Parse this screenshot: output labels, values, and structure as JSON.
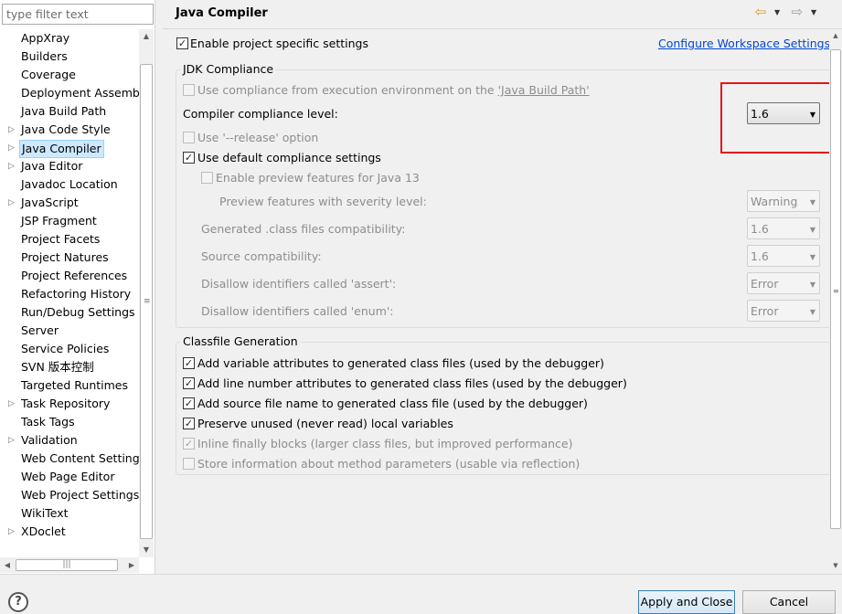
{
  "filter": {
    "placeholder": "type filter text"
  },
  "tree": {
    "items": [
      {
        "label": "AppXray",
        "expandable": false,
        "selected": false
      },
      {
        "label": "Builders",
        "expandable": false,
        "selected": false
      },
      {
        "label": "Coverage",
        "expandable": false,
        "selected": false
      },
      {
        "label": "Deployment Assembly",
        "expandable": false,
        "selected": false
      },
      {
        "label": "Java Build Path",
        "expandable": false,
        "selected": false
      },
      {
        "label": "Java Code Style",
        "expandable": true,
        "selected": false
      },
      {
        "label": "Java Compiler",
        "expandable": true,
        "selected": true
      },
      {
        "label": "Java Editor",
        "expandable": true,
        "selected": false
      },
      {
        "label": "Javadoc Location",
        "expandable": false,
        "selected": false
      },
      {
        "label": "JavaScript",
        "expandable": true,
        "selected": false
      },
      {
        "label": "JSP Fragment",
        "expandable": false,
        "selected": false
      },
      {
        "label": "Project Facets",
        "expandable": false,
        "selected": false
      },
      {
        "label": "Project Natures",
        "expandable": false,
        "selected": false
      },
      {
        "label": "Project References",
        "expandable": false,
        "selected": false
      },
      {
        "label": "Refactoring History",
        "expandable": false,
        "selected": false
      },
      {
        "label": "Run/Debug Settings",
        "expandable": false,
        "selected": false
      },
      {
        "label": "Server",
        "expandable": false,
        "selected": false
      },
      {
        "label": "Service Policies",
        "expandable": false,
        "selected": false
      },
      {
        "label": "SVN 版本控制",
        "expandable": false,
        "selected": false
      },
      {
        "label": "Targeted Runtimes",
        "expandable": false,
        "selected": false
      },
      {
        "label": "Task Repository",
        "expandable": true,
        "selected": false
      },
      {
        "label": "Task Tags",
        "expandable": false,
        "selected": false
      },
      {
        "label": "Validation",
        "expandable": true,
        "selected": false
      },
      {
        "label": "Web Content Settings",
        "expandable": false,
        "selected": false
      },
      {
        "label": "Web Page Editor",
        "expandable": false,
        "selected": false
      },
      {
        "label": "Web Project Settings",
        "expandable": false,
        "selected": false
      },
      {
        "label": "WikiText",
        "expandable": false,
        "selected": false
      },
      {
        "label": "XDoclet",
        "expandable": true,
        "selected": false
      }
    ]
  },
  "header": {
    "title": "Java Compiler",
    "icons": {
      "back": "arrow-left-icon",
      "forward": "arrow-right-icon",
      "menu": "chevron-down-icon"
    }
  },
  "settings": {
    "enable_project_specific": {
      "label": "Enable project specific settings",
      "checked": true
    },
    "configure_workspace_link": "Configure Workspace Settings...",
    "jdk_compliance": {
      "title": "JDK Compliance",
      "use_execution_env": {
        "prefix": "Use compliance from execution environment on the ",
        "link": "'Java Build Path'",
        "checked": false,
        "enabled": false
      },
      "compliance_level": {
        "label": "Compiler compliance level:",
        "value": "1.6"
      },
      "use_release": {
        "label": "Use '--release' option",
        "checked": false,
        "enabled": false
      },
      "use_default": {
        "label": "Use default compliance settings",
        "checked": true
      },
      "enable_preview": {
        "label": "Enable preview features for Java 13",
        "checked": false,
        "enabled": false
      },
      "preview_severity": {
        "label": "Preview features with severity level:",
        "value": "Warning"
      },
      "generated_class": {
        "label": "Generated .class files compatibility:",
        "value": "1.6"
      },
      "source_compat": {
        "label": "Source compatibility:",
        "value": "1.6"
      },
      "disallow_assert": {
        "label": "Disallow identifiers called 'assert':",
        "value": "Error"
      },
      "disallow_enum": {
        "label": "Disallow identifiers called 'enum':",
        "value": "Error"
      }
    },
    "classfile": {
      "title": "Classfile Generation",
      "items": [
        {
          "label": "Add variable attributes to generated class files (used by the debugger)",
          "checked": true,
          "enabled": true
        },
        {
          "label": "Add line number attributes to generated class files (used by the debugger)",
          "checked": true,
          "enabled": true
        },
        {
          "label": "Add source file name to generated class file (used by the debugger)",
          "checked": true,
          "enabled": true
        },
        {
          "label": "Preserve unused (never read) local variables",
          "checked": true,
          "enabled": true
        },
        {
          "label": "Inline finally blocks (larger class files, but improved performance)",
          "checked": true,
          "enabled": false
        },
        {
          "label": "Store information about method parameters (usable via reflection)",
          "checked": false,
          "enabled": false
        }
      ]
    }
  },
  "footer": {
    "help": "?",
    "apply_close": "Apply and Close",
    "cancel": "Cancel"
  },
  "colors": {
    "highlight_box": "#e8131a",
    "link": "#0046d5",
    "selection": "#cde8ff"
  }
}
